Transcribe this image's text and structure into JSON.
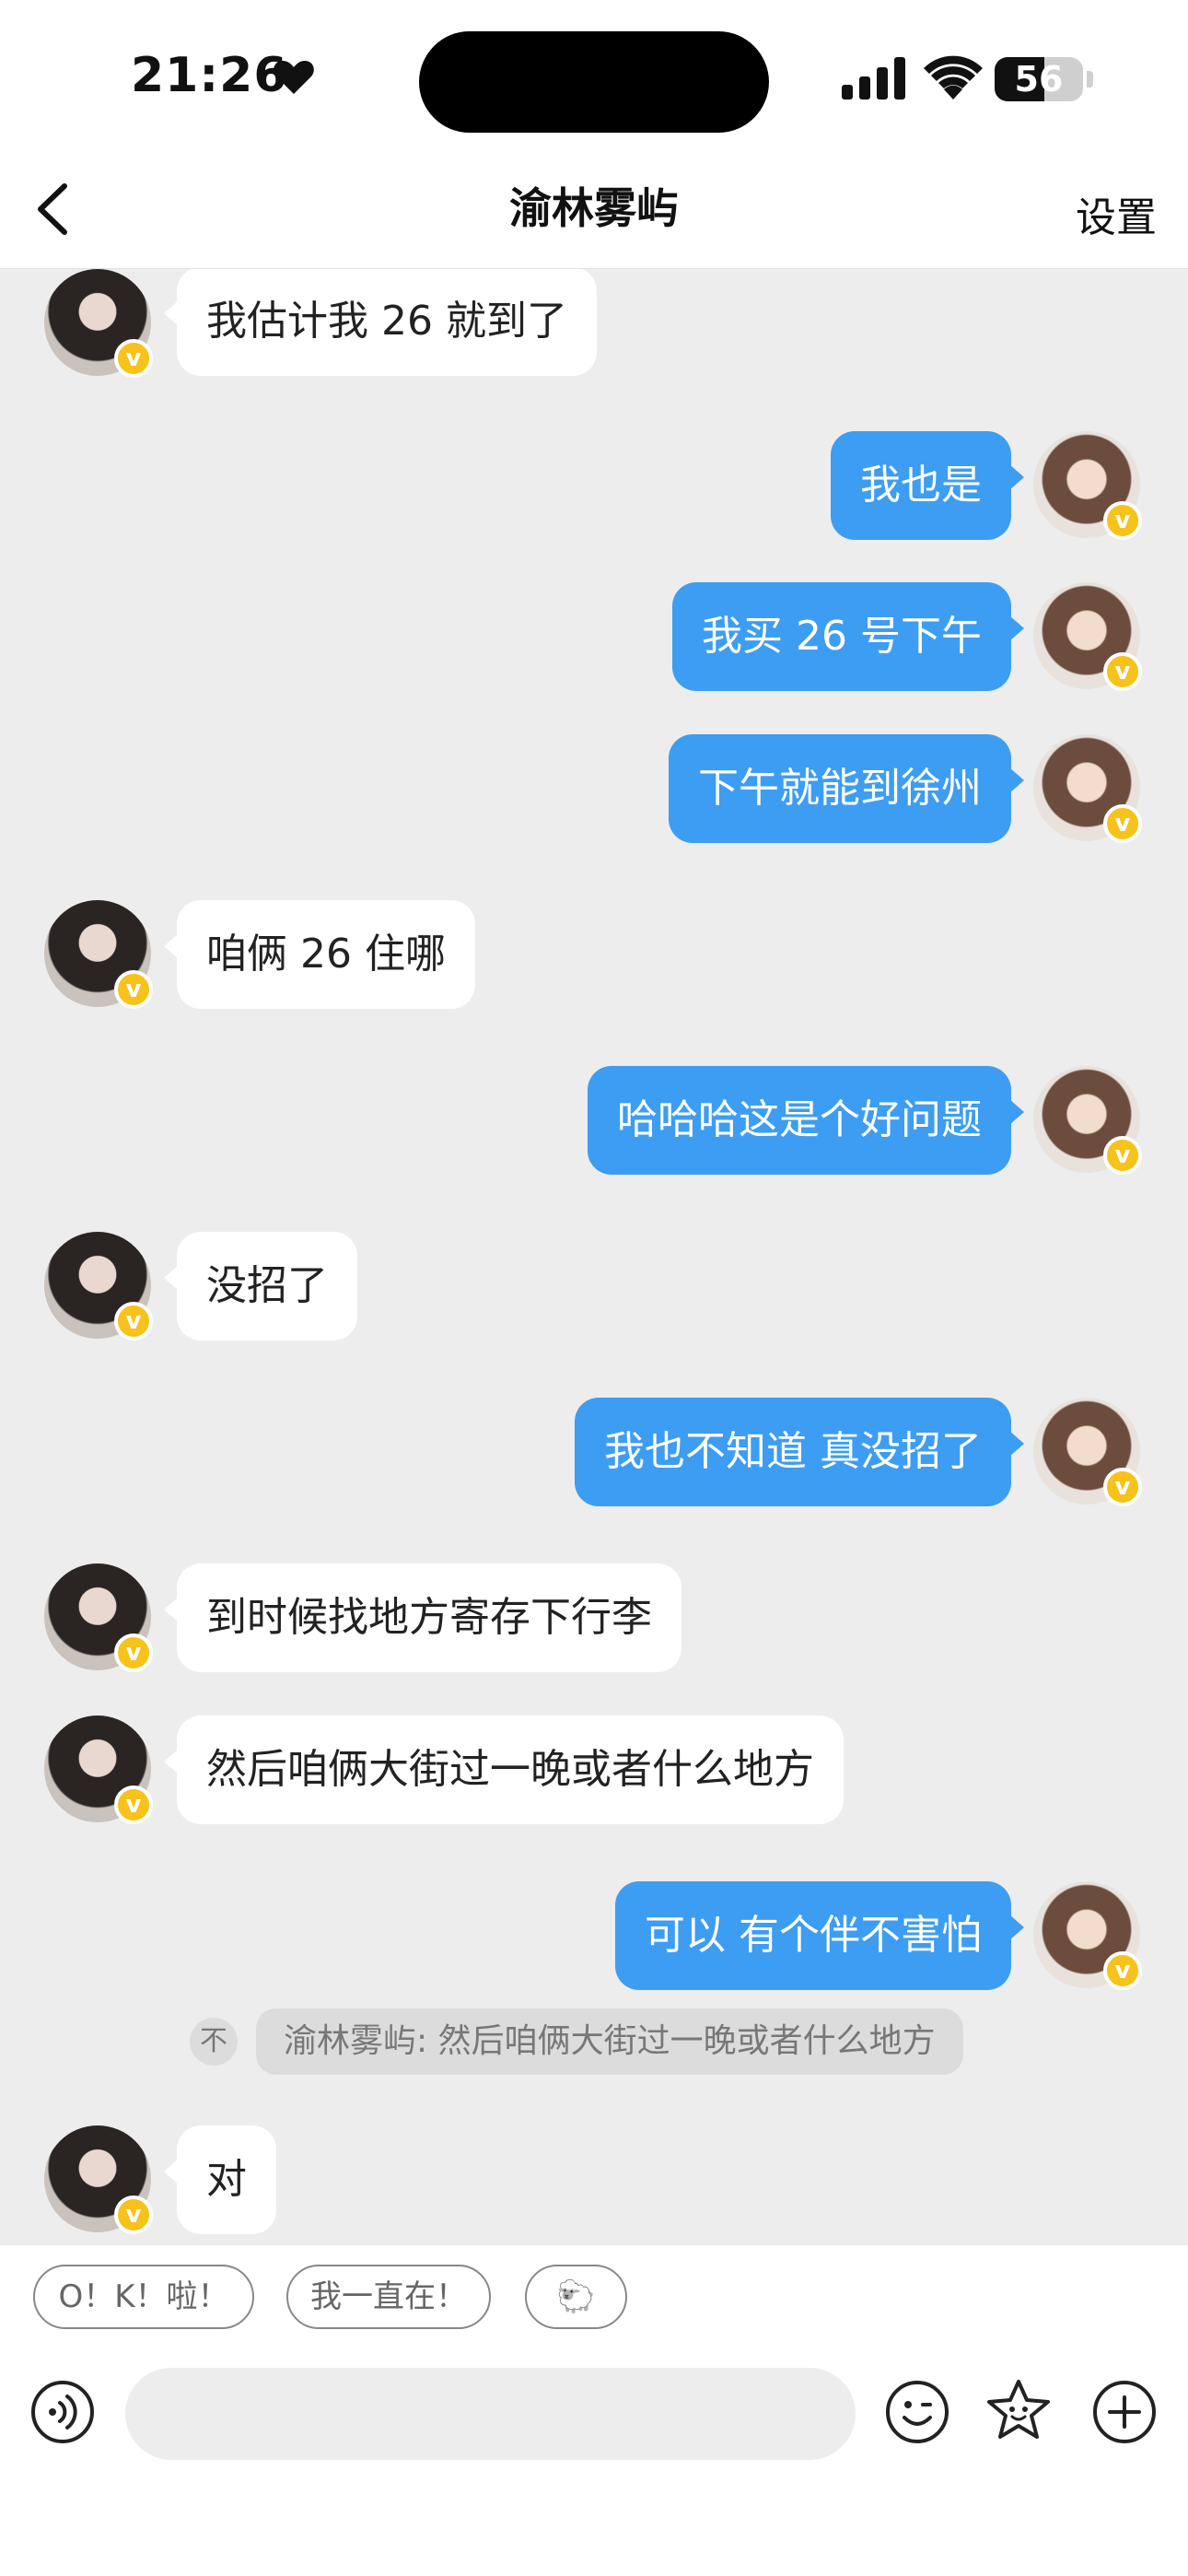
{
  "status_bar": {
    "time": "21:26",
    "battery": "56",
    "battery_level": 0.56
  },
  "nav": {
    "title": "渝林雾屿",
    "settings_label": "设置"
  },
  "messages": [
    {
      "side": "in",
      "text": "我估计我 26 就到了"
    },
    {
      "side": "out",
      "text": "我也是"
    },
    {
      "side": "out",
      "text": "我买 26 号下午"
    },
    {
      "side": "out",
      "text": "下午就能到徐州"
    },
    {
      "side": "in",
      "text": "咱俩 26 住哪"
    },
    {
      "side": "out",
      "text": "哈哈哈这是个好问题"
    },
    {
      "side": "in",
      "text": "没招了"
    },
    {
      "side": "out",
      "text": "我也不知道 真没招了"
    },
    {
      "side": "in",
      "text": "到时候找地方寄存下行李"
    },
    {
      "side": "in",
      "text": "然后咱俩大街过一晚或者什么地方"
    },
    {
      "side": "out",
      "text": "可以 有个伴不害怕"
    },
    {
      "side": "in",
      "text": "对"
    }
  ],
  "quote": {
    "icon_char": "不",
    "text": "渝林雾屿: 然后咱俩大街过一晚或者什么地方"
  },
  "avatar_badge": "v",
  "quick_replies": [
    "O！K！啦！",
    "我一直在！",
    "🐑"
  ],
  "input": {
    "value": "",
    "placeholder": ""
  },
  "colors": {
    "outgoing_bubble": "#3d9df2",
    "incoming_bubble": "#ffffff",
    "background": "#ededed",
    "badge": "#f7c21a"
  },
  "icons": {
    "back": "chevron-left-icon",
    "voice": "voice-icon",
    "emoji": "emoji-icon",
    "sticker": "sticker-icon",
    "plus": "plus-icon"
  }
}
